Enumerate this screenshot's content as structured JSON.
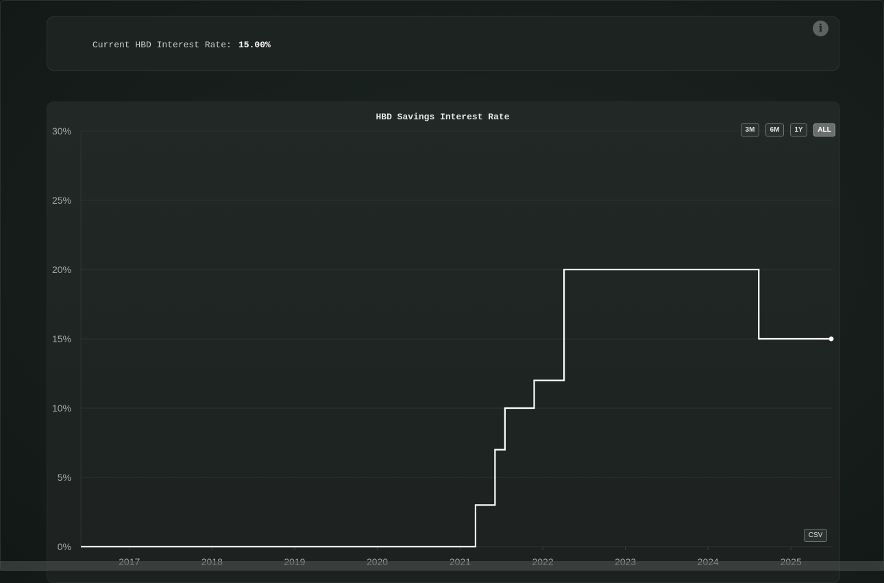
{
  "rate_card": {
    "label": "Current HBD Interest Rate:",
    "value": "15.00%"
  },
  "chart_data": {
    "type": "line",
    "title": "HBD Savings Interest Rate",
    "xlabel": "",
    "ylabel": "",
    "step": true,
    "ylim": [
      0,
      30
    ],
    "xlim": [
      "2016-06-01",
      "2025-07-01"
    ],
    "y_ticks": [
      "0%",
      "5%",
      "10%",
      "15%",
      "20%",
      "25%",
      "30%"
    ],
    "x_ticks": [
      "2017",
      "2018",
      "2019",
      "2020",
      "2021",
      "2022",
      "2023",
      "2024",
      "2025"
    ],
    "grid": true,
    "series": [
      {
        "color": "#ffffff",
        "points": [
          {
            "x": "2016-06-01",
            "y": 0
          },
          {
            "x": "2021-03-10",
            "y": 3
          },
          {
            "x": "2021-06-04",
            "y": 7
          },
          {
            "x": "2021-07-18",
            "y": 10
          },
          {
            "x": "2021-11-24",
            "y": 12
          },
          {
            "x": "2022-04-05",
            "y": 20
          },
          {
            "x": "2024-08-12",
            "y": 15
          },
          {
            "x": "2025-06-28",
            "y": 15
          }
        ]
      }
    ]
  },
  "range_buttons": [
    "3M",
    "6M",
    "1Y",
    "ALL"
  ],
  "active_range": "ALL",
  "csv_label": "CSV",
  "colors": {
    "line": "#ffffff",
    "background": "#1a201e",
    "card": "#1d2321"
  }
}
